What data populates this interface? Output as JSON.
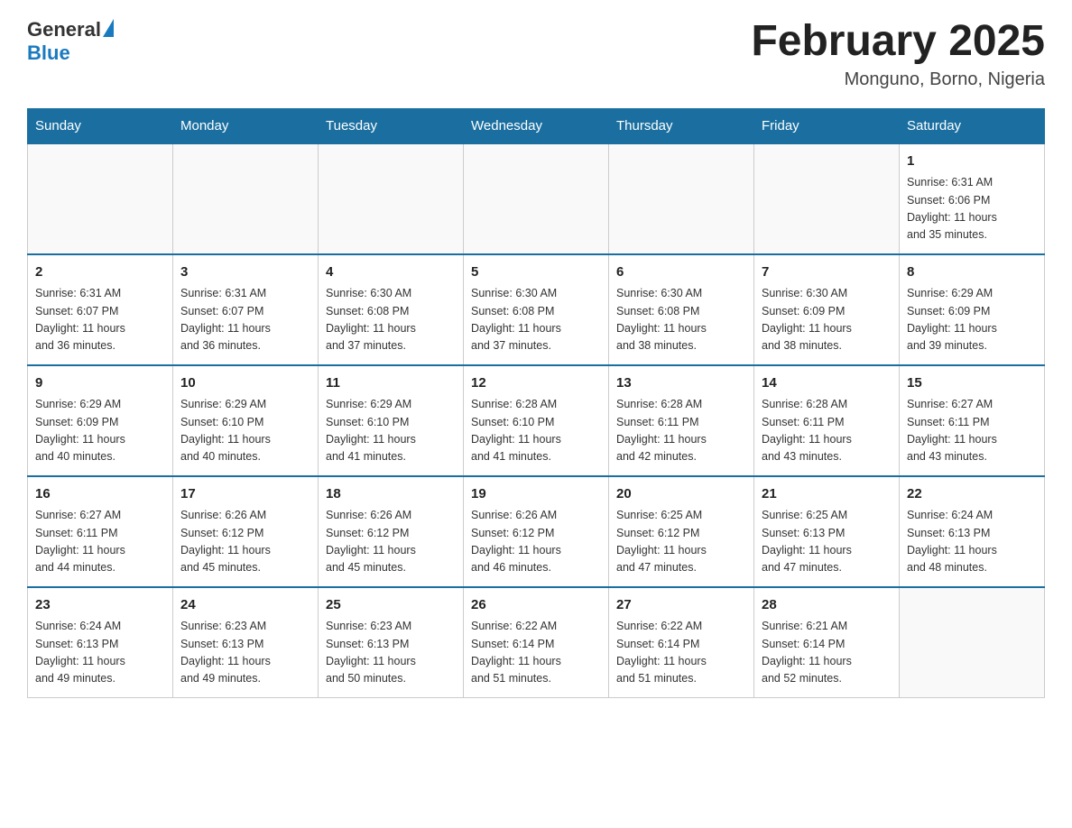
{
  "header": {
    "logo": {
      "general": "General",
      "blue": "Blue"
    },
    "title": "February 2025",
    "location": "Monguno, Borno, Nigeria"
  },
  "days_of_week": [
    "Sunday",
    "Monday",
    "Tuesday",
    "Wednesday",
    "Thursday",
    "Friday",
    "Saturday"
  ],
  "weeks": [
    [
      {
        "day": "",
        "info": ""
      },
      {
        "day": "",
        "info": ""
      },
      {
        "day": "",
        "info": ""
      },
      {
        "day": "",
        "info": ""
      },
      {
        "day": "",
        "info": ""
      },
      {
        "day": "",
        "info": ""
      },
      {
        "day": "1",
        "info": "Sunrise: 6:31 AM\nSunset: 6:06 PM\nDaylight: 11 hours\nand 35 minutes."
      }
    ],
    [
      {
        "day": "2",
        "info": "Sunrise: 6:31 AM\nSunset: 6:07 PM\nDaylight: 11 hours\nand 36 minutes."
      },
      {
        "day": "3",
        "info": "Sunrise: 6:31 AM\nSunset: 6:07 PM\nDaylight: 11 hours\nand 36 minutes."
      },
      {
        "day": "4",
        "info": "Sunrise: 6:30 AM\nSunset: 6:08 PM\nDaylight: 11 hours\nand 37 minutes."
      },
      {
        "day": "5",
        "info": "Sunrise: 6:30 AM\nSunset: 6:08 PM\nDaylight: 11 hours\nand 37 minutes."
      },
      {
        "day": "6",
        "info": "Sunrise: 6:30 AM\nSunset: 6:08 PM\nDaylight: 11 hours\nand 38 minutes."
      },
      {
        "day": "7",
        "info": "Sunrise: 6:30 AM\nSunset: 6:09 PM\nDaylight: 11 hours\nand 38 minutes."
      },
      {
        "day": "8",
        "info": "Sunrise: 6:29 AM\nSunset: 6:09 PM\nDaylight: 11 hours\nand 39 minutes."
      }
    ],
    [
      {
        "day": "9",
        "info": "Sunrise: 6:29 AM\nSunset: 6:09 PM\nDaylight: 11 hours\nand 40 minutes."
      },
      {
        "day": "10",
        "info": "Sunrise: 6:29 AM\nSunset: 6:10 PM\nDaylight: 11 hours\nand 40 minutes."
      },
      {
        "day": "11",
        "info": "Sunrise: 6:29 AM\nSunset: 6:10 PM\nDaylight: 11 hours\nand 41 minutes."
      },
      {
        "day": "12",
        "info": "Sunrise: 6:28 AM\nSunset: 6:10 PM\nDaylight: 11 hours\nand 41 minutes."
      },
      {
        "day": "13",
        "info": "Sunrise: 6:28 AM\nSunset: 6:11 PM\nDaylight: 11 hours\nand 42 minutes."
      },
      {
        "day": "14",
        "info": "Sunrise: 6:28 AM\nSunset: 6:11 PM\nDaylight: 11 hours\nand 43 minutes."
      },
      {
        "day": "15",
        "info": "Sunrise: 6:27 AM\nSunset: 6:11 PM\nDaylight: 11 hours\nand 43 minutes."
      }
    ],
    [
      {
        "day": "16",
        "info": "Sunrise: 6:27 AM\nSunset: 6:11 PM\nDaylight: 11 hours\nand 44 minutes."
      },
      {
        "day": "17",
        "info": "Sunrise: 6:26 AM\nSunset: 6:12 PM\nDaylight: 11 hours\nand 45 minutes."
      },
      {
        "day": "18",
        "info": "Sunrise: 6:26 AM\nSunset: 6:12 PM\nDaylight: 11 hours\nand 45 minutes."
      },
      {
        "day": "19",
        "info": "Sunrise: 6:26 AM\nSunset: 6:12 PM\nDaylight: 11 hours\nand 46 minutes."
      },
      {
        "day": "20",
        "info": "Sunrise: 6:25 AM\nSunset: 6:12 PM\nDaylight: 11 hours\nand 47 minutes."
      },
      {
        "day": "21",
        "info": "Sunrise: 6:25 AM\nSunset: 6:13 PM\nDaylight: 11 hours\nand 47 minutes."
      },
      {
        "day": "22",
        "info": "Sunrise: 6:24 AM\nSunset: 6:13 PM\nDaylight: 11 hours\nand 48 minutes."
      }
    ],
    [
      {
        "day": "23",
        "info": "Sunrise: 6:24 AM\nSunset: 6:13 PM\nDaylight: 11 hours\nand 49 minutes."
      },
      {
        "day": "24",
        "info": "Sunrise: 6:23 AM\nSunset: 6:13 PM\nDaylight: 11 hours\nand 49 minutes."
      },
      {
        "day": "25",
        "info": "Sunrise: 6:23 AM\nSunset: 6:13 PM\nDaylight: 11 hours\nand 50 minutes."
      },
      {
        "day": "26",
        "info": "Sunrise: 6:22 AM\nSunset: 6:14 PM\nDaylight: 11 hours\nand 51 minutes."
      },
      {
        "day": "27",
        "info": "Sunrise: 6:22 AM\nSunset: 6:14 PM\nDaylight: 11 hours\nand 51 minutes."
      },
      {
        "day": "28",
        "info": "Sunrise: 6:21 AM\nSunset: 6:14 PM\nDaylight: 11 hours\nand 52 minutes."
      },
      {
        "day": "",
        "info": ""
      }
    ]
  ]
}
